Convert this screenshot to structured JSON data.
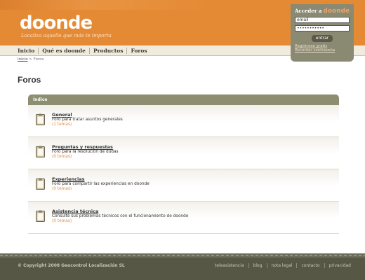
{
  "header": {
    "logo": "doonde",
    "tagline": "Localiza aquello que más te importa"
  },
  "nav": {
    "items": [
      "Inicio",
      "Qué es doonde",
      "Productos",
      "Foros"
    ]
  },
  "login": {
    "title": "Acceder a",
    "brand": "doonde",
    "email_value": "email",
    "password_value": "•••••••••••",
    "submit_label": "entrar",
    "register_label": "Registrese gratis",
    "forgot_label": "Recordar contraseña"
  },
  "breadcrumb": {
    "home": "Inicio",
    "separator": " > ",
    "current": "Foros"
  },
  "page_title": "Foros",
  "panel": {
    "header": "Índice",
    "forums": [
      {
        "title": "General",
        "description": "Foro para tratar asuntos generales",
        "count": "(1 temas)"
      },
      {
        "title": "Preguntas y respuestas",
        "description": "Foro para la resolución de dudas",
        "count": "(0 temas)"
      },
      {
        "title": "Experiencias",
        "description": "Foro para compartir las experiencias en doonde",
        "count": "(0 temas)"
      },
      {
        "title": "Asistencia técnica",
        "description": "Consulte sus problemas técnicos con el funcionamiento de doonde",
        "count": "(0 temas)"
      }
    ]
  },
  "footer": {
    "copyright": "© Copyright 2008 Geocontrol Localización SL",
    "links": [
      "teleasistencia",
      "blog",
      "nota legal",
      "contacto",
      "privacidad"
    ]
  },
  "colors": {
    "header_orange": "#e58a34",
    "panel_header": "#8d8d72",
    "footer": "#575745",
    "count_orange": "#e8893a"
  },
  "icons": {
    "forum": "clipboard-icon"
  }
}
